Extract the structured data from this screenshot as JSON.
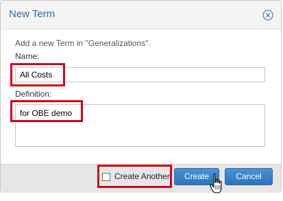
{
  "dialog": {
    "title": "New Term",
    "intro": "Add a new Term in \"Generalizations\".",
    "name_label": "Name:",
    "name_value": "All Costs",
    "definition_label": "Definition:",
    "definition_value": "for OBE demo"
  },
  "footer": {
    "create_another_label": "Create Another",
    "create_another_checked": false,
    "create_label": "Create",
    "cancel_label": "Cancel"
  },
  "icons": {
    "close": "close-circle-icon",
    "cursor": "hand-pointer-icon"
  },
  "colors": {
    "title": "#2f6ea9",
    "primary_button": "#3a82c8",
    "highlight": "#d0021b"
  }
}
